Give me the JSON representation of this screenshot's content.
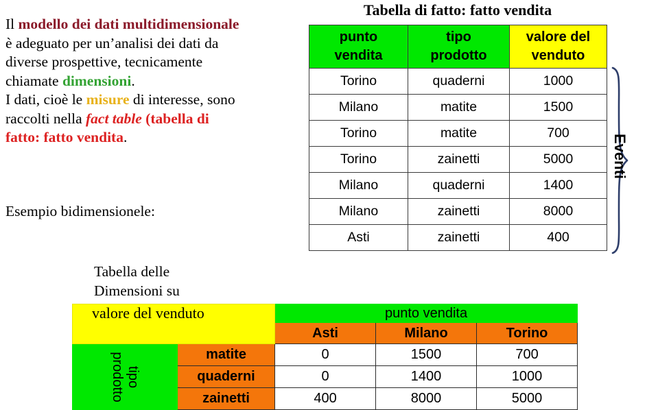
{
  "intro": {
    "line1_plain_a": "Il ",
    "line1_bold": "modello dei dati multidimensionale",
    "line2": "è adeguato per un’analisi dei dati da",
    "line3": "diverse prospettive, tecnicamente",
    "line4_plain": "chiamate ",
    "line4_green": "dimensioni",
    "line4_end": ".",
    "line5_a": "I dati, cioè le ",
    "line5_gold": "misure",
    "line5_b": " di interesse, sono",
    "line6_a": "raccolti nella ",
    "line6_italic": "fact table",
    "line6_b": " (tabella di",
    "line7_red": "fatto: fatto vendita",
    "line7_end": ".",
    "esempio": "Esempio bidimensionele:"
  },
  "fact_table": {
    "title": "Tabella di fatto: fatto vendita",
    "headers": [
      "punto vendita",
      "tipo prodotto",
      "valore del venduto"
    ],
    "header_line1": [
      "punto",
      "tipo",
      "valore del"
    ],
    "header_line2": [
      "vendita",
      "prodotto",
      "venduto"
    ],
    "rows": [
      [
        "Torino",
        "quaderni",
        "1000"
      ],
      [
        "Milano",
        "matite",
        "1500"
      ],
      [
        "Torino",
        "matite",
        "700"
      ],
      [
        "Torino",
        "zainetti",
        "5000"
      ],
      [
        "Milano",
        "quaderni",
        "1400"
      ],
      [
        "Milano",
        "zainetti",
        "8000"
      ],
      [
        "Asti",
        "zainetti",
        "400"
      ]
    ],
    "brace_label": "Eventi"
  },
  "pivot": {
    "caption_line1": "Tabella delle",
    "caption_line2": "Dimensioni su",
    "measure_label": "valore del venduto",
    "column_dimension": "punto vendita",
    "row_dimension": "tipo prodotto",
    "row_dimension_line1": "tipo",
    "row_dimension_line2": "prodotto",
    "column_headers": [
      "Asti",
      "Milano",
      "Torino"
    ],
    "row_headers": [
      "matite",
      "quaderni",
      "zainetti"
    ],
    "values": [
      [
        "0",
        "1500",
        "700"
      ],
      [
        "0",
        "1400",
        "1000"
      ],
      [
        "400",
        "8000",
        "5000"
      ]
    ]
  },
  "colors": {
    "green": "#00E800",
    "yellow": "#FFFF00",
    "orange": "#F4760B",
    "maroon": "#8B1A2A",
    "red": "#DD2222",
    "gold": "#E8B21C",
    "text_green": "#33A333",
    "brace_blue": "#2F3F6B"
  }
}
